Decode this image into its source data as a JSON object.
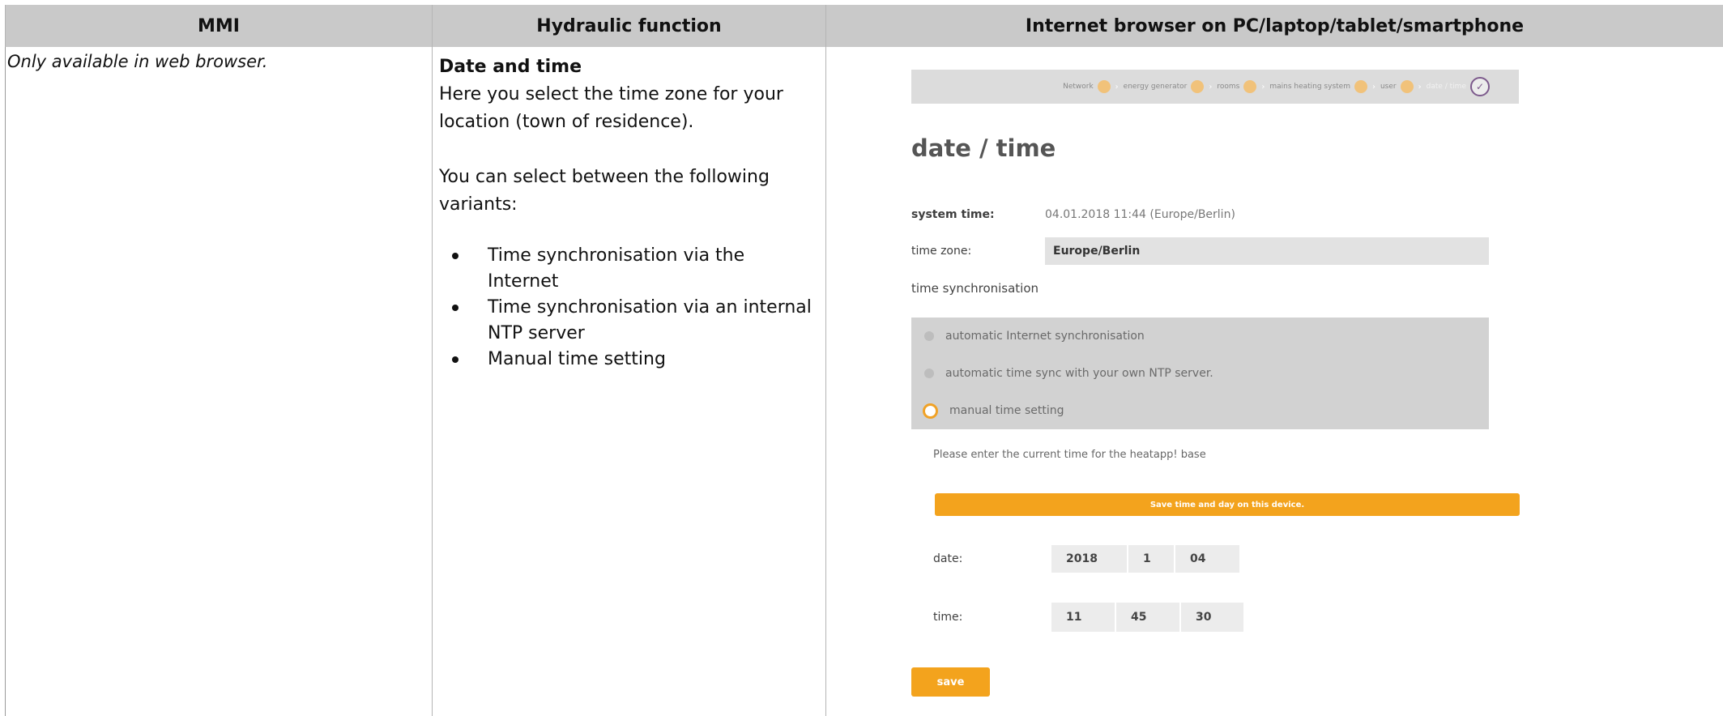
{
  "table": {
    "headers": {
      "mmi": "MMI",
      "hydraulic": "Hydraulic function",
      "browser": "Internet browser on PC/laptop/tablet/smartphone"
    }
  },
  "mmi": {
    "note": "Only available in web browser."
  },
  "hydraulic": {
    "heading": "Date and time",
    "intro_line1": "Here you select the time zone for your",
    "intro_line2": "location (town of residence).",
    "select_line1": "You can select between the following",
    "select_line2": "variants:",
    "variants": [
      "Time synchronisation via the Internet",
      "Time synchronisation via an internal NTP server",
      "Manual time setting"
    ]
  },
  "screenshot": {
    "breadcrumb": {
      "steps": [
        "Network",
        "energy generator",
        "rooms",
        "mains heating system",
        "user",
        "date / time"
      ]
    },
    "title": "date / time",
    "system_time_label": "system time:",
    "system_time_value": "04.01.2018 11:44 (Europe/Berlin)",
    "time_zone_label": "time zone:",
    "time_zone_value": "Europe/Berlin",
    "sync_title": "time synchronisation",
    "options": [
      "automatic Internet synchronisation",
      "automatic time sync with your own NTP server.",
      "manual time setting"
    ],
    "selected_option_index": 2,
    "hint": "Please enter the current time for the heatapp! base",
    "take_device_time_button": "Save time and day on this device.",
    "date_label": "date:",
    "date_values": [
      "2018",
      "1",
      "04"
    ],
    "time_label": "time:",
    "time_values": [
      "11",
      "45",
      "30"
    ],
    "save_button": "save",
    "accent_color": "#f3a31d"
  }
}
